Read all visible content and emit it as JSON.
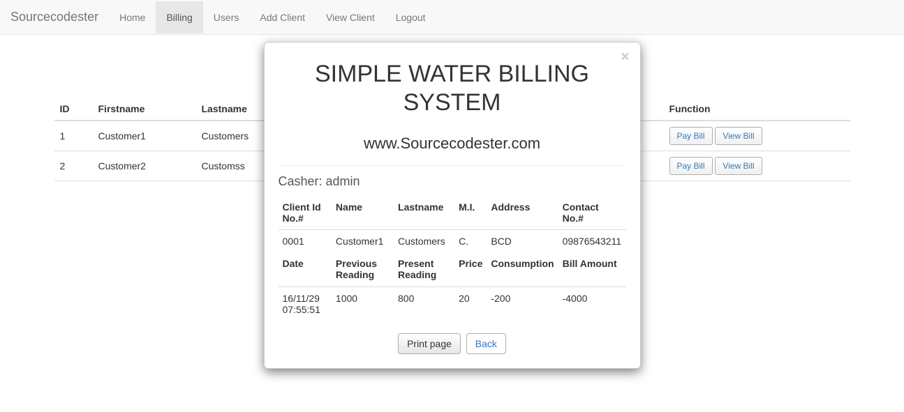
{
  "navbar": {
    "brand": "Sourcecodester",
    "items": [
      {
        "label": "Home",
        "active": false
      },
      {
        "label": "Billing",
        "active": true
      },
      {
        "label": "Users",
        "active": false
      },
      {
        "label": "Add Client",
        "active": false
      },
      {
        "label": "View Client",
        "active": false
      },
      {
        "label": "Logout",
        "active": false
      }
    ]
  },
  "table": {
    "headers": {
      "id": "ID",
      "firstname": "Firstname",
      "lastname": "Lastname",
      "function": "Function"
    },
    "rows": [
      {
        "id": "1",
        "firstname": "Customer1",
        "lastname": "Customers"
      },
      {
        "id": "2",
        "firstname": "Customer2",
        "lastname": "Customss"
      }
    ],
    "buttons": {
      "pay": "Pay Bill",
      "view": "View Bill"
    }
  },
  "modal": {
    "title": "SIMPLE WATER BILLING SYSTEM",
    "subtitle": "www.Sourcecodester.com",
    "casher_label": "Casher: ",
    "casher_value": "admin",
    "client_headers": {
      "client_id": "Client Id No.#",
      "name": "Name",
      "lastname": "Lastname",
      "mi": "M.I.",
      "address": "Address",
      "contact": "Contact No.#"
    },
    "client_row": {
      "client_id": "0001",
      "name": "Customer1",
      "lastname": "Customers",
      "mi": "C.",
      "address": "BCD",
      "contact": "09876543211"
    },
    "bill_headers": {
      "date": "Date",
      "previous": "Previous Reading",
      "present": "Present Reading",
      "price": "Price",
      "consumption": "Consumption",
      "amount": "Bill Amount"
    },
    "bill_row": {
      "date": "16/11/29 07:55:51",
      "previous": "1000",
      "present": "800",
      "price": "20",
      "consumption": "-200",
      "amount": "-4000"
    },
    "actions": {
      "print": "Print page",
      "back": "Back"
    },
    "close": "×"
  }
}
